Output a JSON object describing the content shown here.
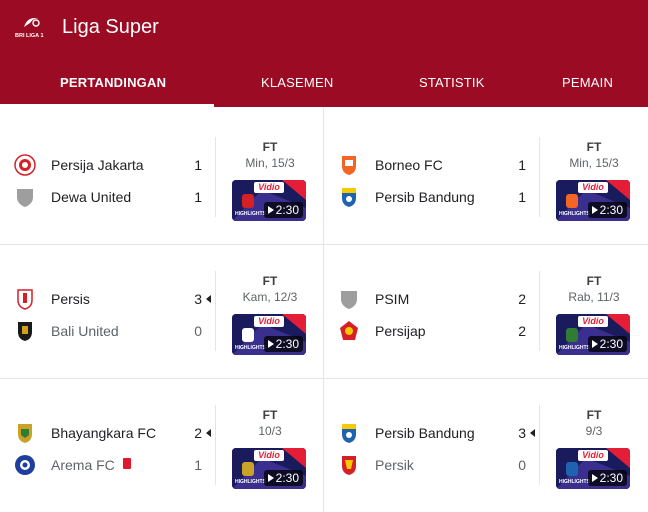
{
  "header": {
    "league_logo_text": "BRI LIGA 1",
    "title": "Liga Super"
  },
  "tabs": [
    {
      "label": "PERTANDINGAN",
      "active": true
    },
    {
      "label": "KLASEMEN",
      "active": false
    },
    {
      "label": "STATISTIK",
      "active": false
    },
    {
      "label": "PEMAIN",
      "active": false
    }
  ],
  "colors": {
    "brand": "#9b0b23",
    "highlight_bg": "#1a1b5c",
    "red_card": "#e0192e"
  },
  "matches": [
    {
      "status": "FT",
      "date": "Min, 15/3",
      "home": {
        "name": "Persija Jakarta",
        "score": "1",
        "crest": "persija-crest-icon"
      },
      "away": {
        "name": "Dewa United",
        "score": "1",
        "crest": "generic-shield-icon"
      },
      "highlight": {
        "brand": "Vidio",
        "label": "HIGHLIGHTS",
        "duration": "2:30"
      }
    },
    {
      "status": "FT",
      "date": "Min, 15/3",
      "home": {
        "name": "Borneo FC",
        "score": "1",
        "crest": "borneo-crest-icon"
      },
      "away": {
        "name": "Persib Bandung",
        "score": "1",
        "crest": "persib-crest-icon"
      },
      "highlight": {
        "brand": "Vidio",
        "label": "HIGHLIGHTS",
        "duration": "2:30"
      }
    },
    {
      "status": "FT",
      "date": "Kam, 12/3",
      "home": {
        "name": "Persis",
        "score": "3",
        "crest": "persis-crest-icon",
        "winner": true
      },
      "away": {
        "name": "Bali United",
        "score": "0",
        "crest": "bali-united-crest-icon"
      },
      "highlight": {
        "brand": "Vidio",
        "label": "HIGHLIGHTS",
        "duration": "2:30"
      }
    },
    {
      "status": "FT",
      "date": "Rab, 11/3",
      "home": {
        "name": "PSIM",
        "score": "2",
        "crest": "generic-shield-icon"
      },
      "away": {
        "name": "Persijap",
        "score": "2",
        "crest": "persijap-crest-icon"
      },
      "highlight": {
        "brand": "Vidio",
        "label": "HIGHLIGHTS",
        "duration": "2:30"
      }
    },
    {
      "status": "FT",
      "date": "10/3",
      "home": {
        "name": "Bhayangkara FC",
        "score": "2",
        "crest": "bhayangkara-crest-icon",
        "winner": true
      },
      "away": {
        "name": "Arema FC",
        "score": "1",
        "crest": "arema-crest-icon",
        "red_card": true
      },
      "highlight": {
        "brand": "Vidio",
        "label": "HIGHLIGHTS",
        "duration": "2:30"
      }
    },
    {
      "status": "FT",
      "date": "9/3",
      "home": {
        "name": "Persib Bandung",
        "score": "3",
        "crest": "persib-crest-icon",
        "winner": true
      },
      "away": {
        "name": "Persik",
        "score": "0",
        "crest": "persik-crest-icon"
      },
      "highlight": {
        "brand": "Vidio",
        "label": "HIGHLIGHTS",
        "duration": "2:30"
      }
    }
  ]
}
